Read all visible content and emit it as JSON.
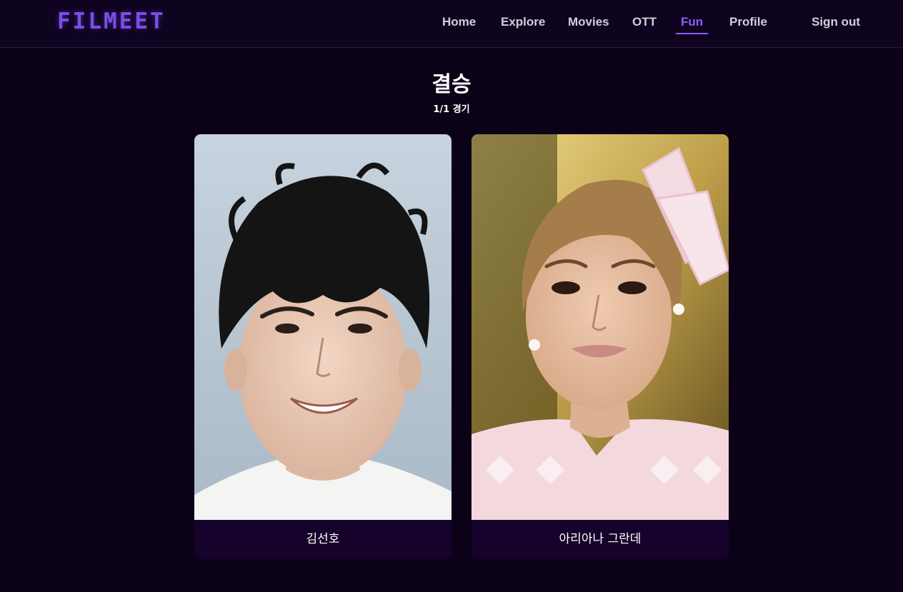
{
  "app": {
    "logo": "FILMEET"
  },
  "nav": {
    "home": "Home",
    "explore": "Explore",
    "movies": "Movies",
    "ott": "OTT",
    "fun": "Fun",
    "profile": "Profile",
    "sign_out": "Sign out",
    "active": "Fun",
    "accent_color": "#8b5cf6"
  },
  "tournament": {
    "round_title": "결승",
    "match_count": "1/1 경기",
    "candidates": [
      {
        "name": "김선호"
      },
      {
        "name": "아리아나 그란데"
      }
    ]
  }
}
